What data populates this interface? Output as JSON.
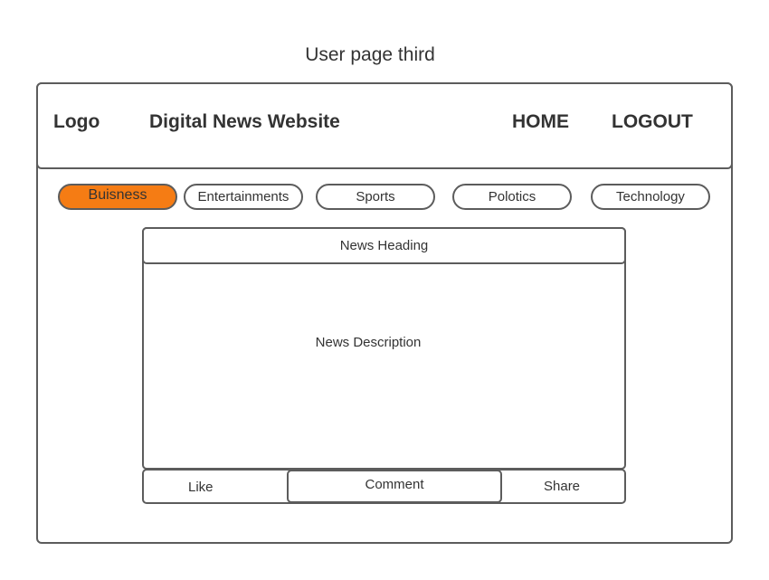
{
  "page": {
    "title": "User page third"
  },
  "header": {
    "logo": "Logo",
    "site_title": "Digital News Website",
    "nav": {
      "home": "HOME",
      "logout": "LOGOUT"
    }
  },
  "categories": {
    "active_color": "#f57c14",
    "items": [
      {
        "label": "Buisness",
        "active": true
      },
      {
        "label": "Entertainments",
        "active": false
      },
      {
        "label": "Sports",
        "active": false
      },
      {
        "label": "Polotics",
        "active": false
      },
      {
        "label": "Technology",
        "active": false
      }
    ]
  },
  "news": {
    "heading": "News Heading",
    "description": "News Description"
  },
  "actions": {
    "like": "Like",
    "comment": "Comment",
    "share": "Share"
  }
}
